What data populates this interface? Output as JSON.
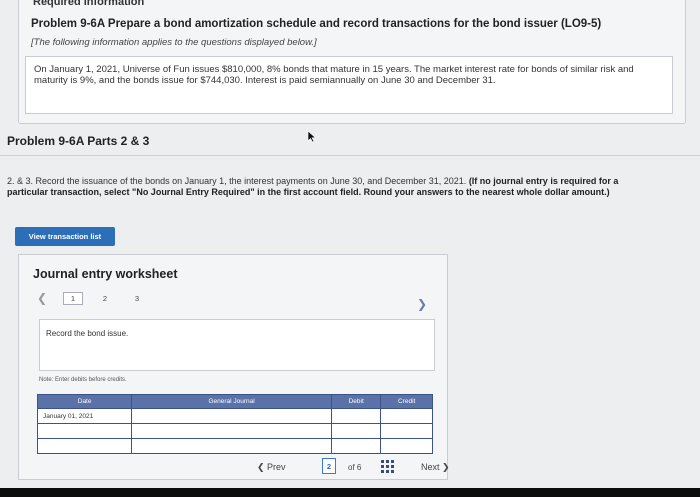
{
  "header": {
    "required_label": "Required information",
    "problem_title": "Problem 9-6A Prepare a bond amortization schedule and record transactions for the bond issuer (LO9-5)",
    "note": "[The following information applies to the questions displayed below.]",
    "description": "On January 1, 2021, Universe of Fun issues $810,000, 8% bonds that mature in 15 years. The market interest rate for bonds of similar risk and maturity is 9%, and the bonds issue for $744,030. Interest is paid semiannually on June 30 and December 31."
  },
  "parts_title": "Problem 9-6A Parts 2 & 3",
  "instructions": {
    "text": "2. & 3. Record the issuance of the bonds on January 1, the interest payments on June 30, and December 31, 2021.",
    "bold": "(If no journal entry is required for a particular transaction, select \"No Journal Entry Required\" in the first account field. Round your answers to the nearest whole dollar amount.)"
  },
  "view_button": "View transaction list",
  "worksheet": {
    "title": "Journal entry worksheet",
    "pages": [
      "1",
      "2",
      "3"
    ],
    "active_page": "1",
    "task": "Record the bond issue.",
    "note": "Note: Enter debits before credits.",
    "columns": [
      "Date",
      "General Journal",
      "Debit",
      "Credit"
    ],
    "rows": [
      {
        "date": "January 01, 2021",
        "account": "",
        "debit": "",
        "credit": ""
      },
      {
        "date": "",
        "account": "",
        "debit": "",
        "credit": ""
      },
      {
        "date": "",
        "account": "",
        "debit": "",
        "credit": ""
      }
    ]
  },
  "footer": {
    "prev": "Prev",
    "page": "2",
    "of": "of 6",
    "next": "Next"
  },
  "colors": {
    "accent": "#2c6fb8",
    "table_header": "#5a72a8"
  }
}
